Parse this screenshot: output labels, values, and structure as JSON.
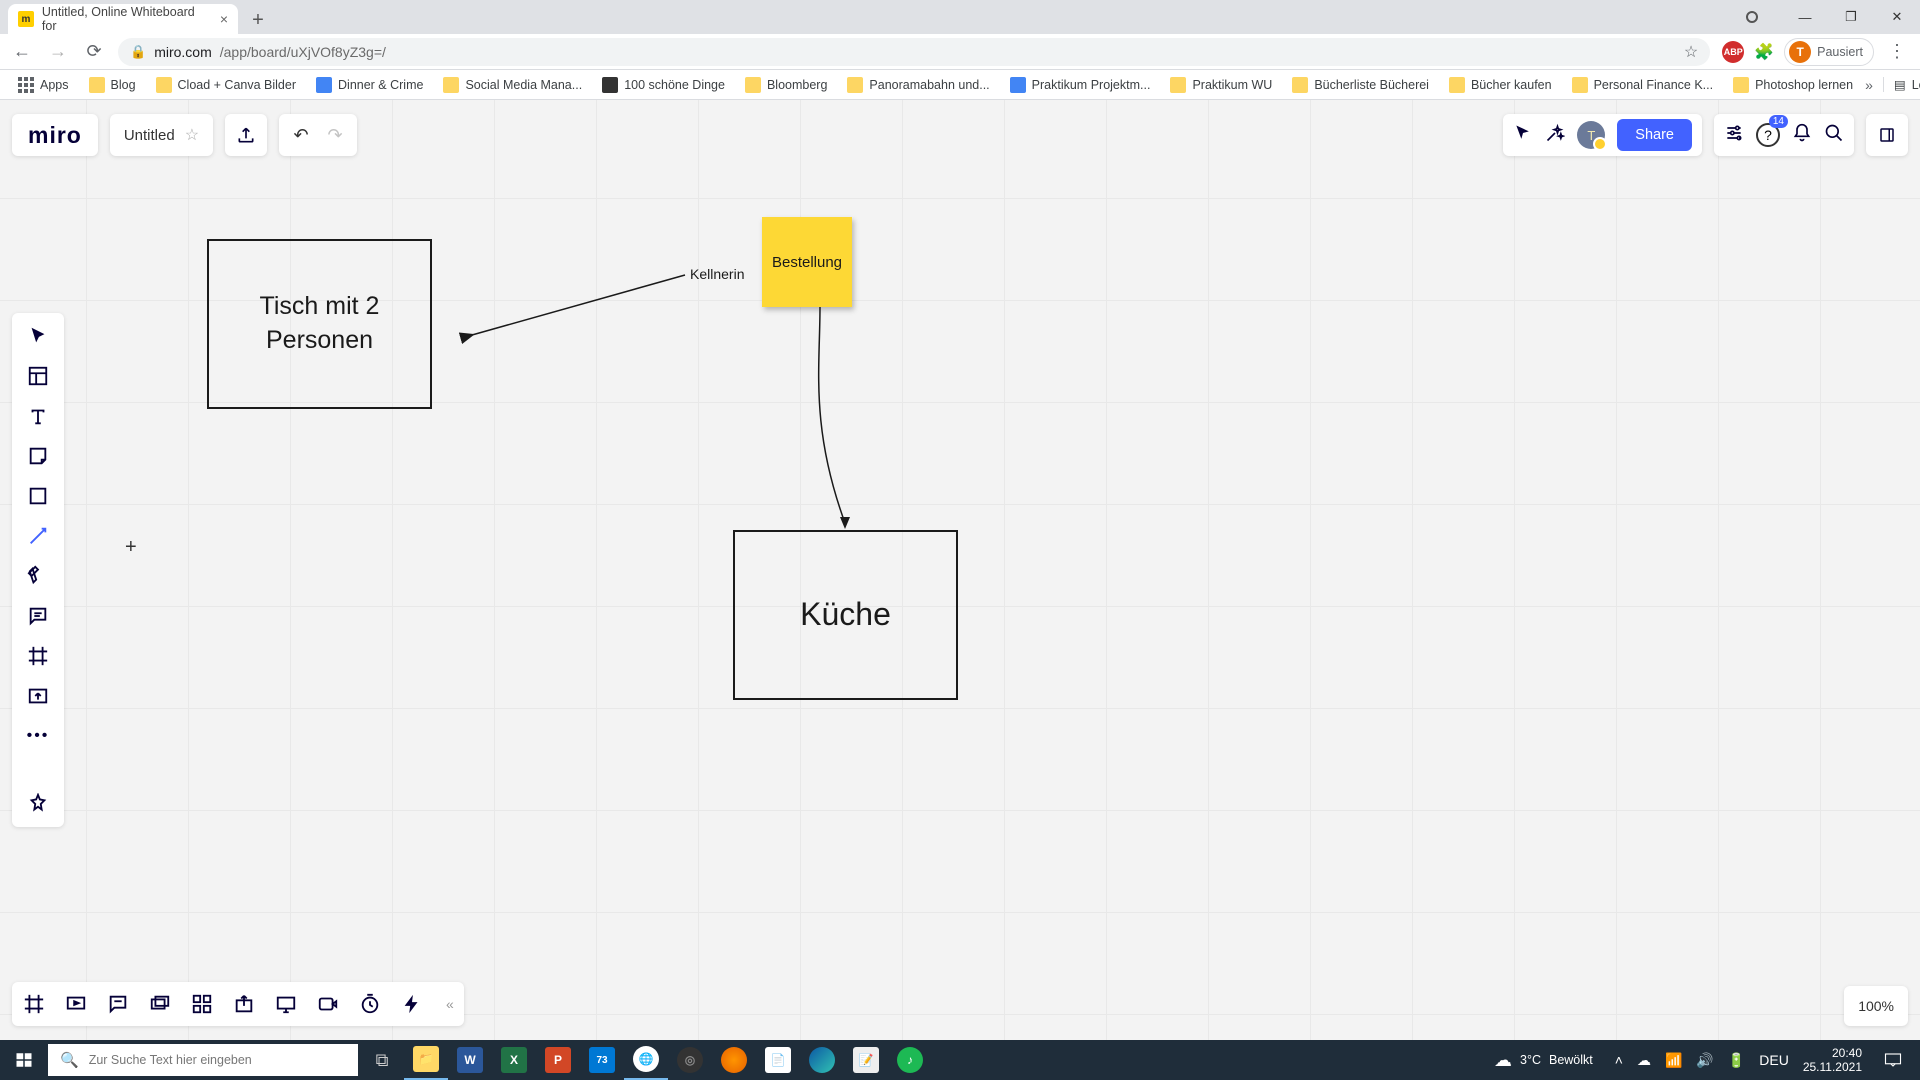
{
  "browser": {
    "tab_title": "Untitled, Online Whiteboard for",
    "url_domain": "miro.com",
    "url_path": "/app/board/uXjVOf8yZ3g=/",
    "profile_state": "Pausiert",
    "profile_initial": "T",
    "bookmarks": [
      "Apps",
      "Blog",
      "Cload + Canva Bilder",
      "Dinner & Crime",
      "Social Media Mana...",
      "100 schöne Dinge",
      "Bloomberg",
      "Panoramabahn und...",
      "Praktikum Projektm...",
      "Praktikum WU",
      "Bücherliste Bücherei",
      "Bücher kaufen",
      "Personal Finance K...",
      "Photoshop lernen"
    ],
    "readlist_label": "Leseliste"
  },
  "miro": {
    "logo": "miro",
    "title": "Untitled",
    "share_label": "Share",
    "help_badge": "14",
    "zoom": "100%",
    "avatar_initial": "T"
  },
  "canvas": {
    "box1_text": "Tisch mit 2 Personen",
    "text_kellnerin": "Kellnerin",
    "sticky_text": "Bestellung",
    "box2_text": "Küche"
  },
  "taskbar": {
    "search_placeholder": "Zur Suche Text hier eingeben",
    "weather_temp": "3°C",
    "weather_desc": "Bewölkt",
    "lang": "DEU",
    "time": "20:40",
    "date": "25.11.2021",
    "calendar_badge": "73"
  }
}
